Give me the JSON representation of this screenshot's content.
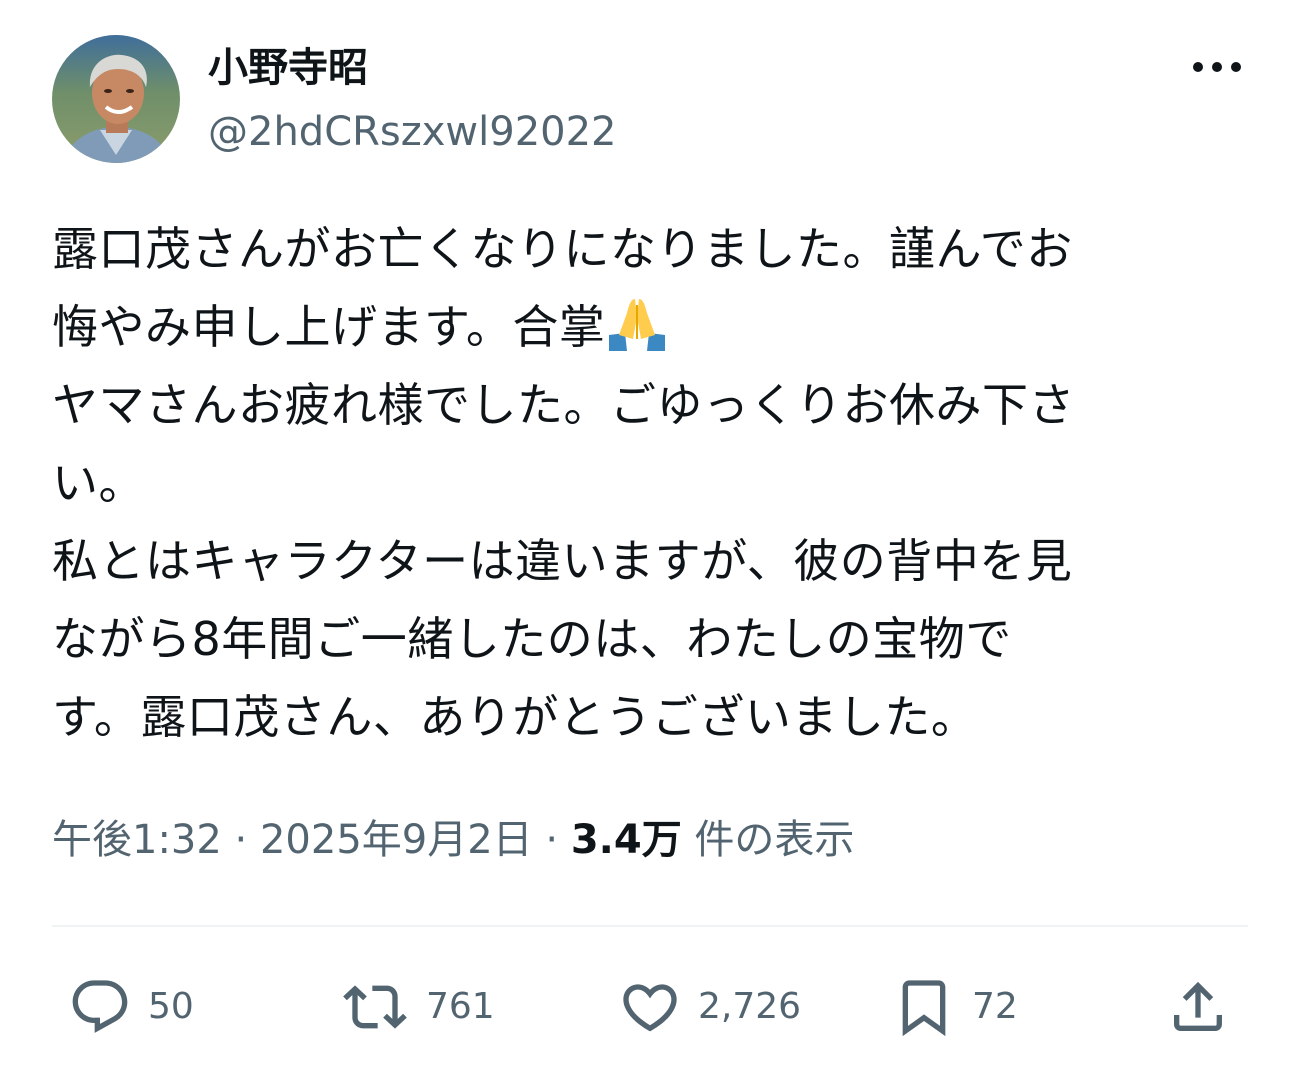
{
  "author": {
    "display_name": "小野寺昭",
    "handle": "@2hdCRszxwl92022"
  },
  "more_icon": "more-horizontal-icon",
  "text": {
    "lines": [
      "露口茂さんがお亡くなりになりました。謹んでお",
      "悔やみ申し上げます。合掌",
      "ヤマさんお疲れ様でした。ごゆっくりお休み下さ",
      "い。",
      "私とはキャラクターは違いますが、彼の背中を見",
      "ながら8年間ご一緒したのは、わたしの宝物で",
      "す。露口茂さん、ありがとうございました。"
    ],
    "emoji": "folded-hands-emoji"
  },
  "meta": {
    "time": "午後1:32",
    "separator": " · ",
    "date": "2025年9月2日",
    "views_count": "3.4万",
    "views_label": " 件の表示"
  },
  "actions": {
    "reply": {
      "icon": "reply-icon",
      "count": "50"
    },
    "retweet": {
      "icon": "retweet-icon",
      "count": "761"
    },
    "like": {
      "icon": "heart-icon",
      "count": "2,726"
    },
    "bookmark": {
      "icon": "bookmark-icon",
      "count": "72"
    },
    "share": {
      "icon": "share-icon"
    }
  },
  "colors": {
    "text_primary": "#0f1419",
    "text_secondary": "#536471",
    "divider": "#eff3f4",
    "background": "#ffffff"
  }
}
